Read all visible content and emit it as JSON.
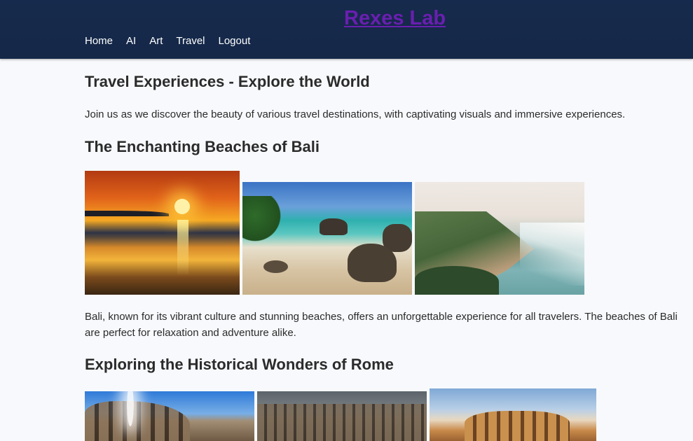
{
  "header": {
    "brand": "Rexes Lab",
    "nav": [
      "Home",
      "AI",
      "Art",
      "Travel",
      "Logout"
    ]
  },
  "main": {
    "title": "Travel Experiences - Explore the World",
    "intro": "Join us as we discover the beauty of various travel destinations, with captivating visuals and immersive experiences.",
    "sections": [
      {
        "heading": "The Enchanting Beaches of Bali",
        "description": "Bali, known for its vibrant culture and stunning beaches, offers an unforgettable experience for all travelers. The beaches of Bali are perfect for relaxation and adventure alike.",
        "photos": [
          "sunset-beach-photo",
          "rocky-cove-photo",
          "coastline-cliff-photo"
        ]
      },
      {
        "heading": "Exploring the Historical Wonders of Rome",
        "photos": [
          "colosseum-sunburst-photo",
          "colosseum-interior-photo",
          "colosseum-exterior-photo"
        ]
      }
    ]
  },
  "colors": {
    "header_bg": "#152848",
    "brand": "#6a1fb0",
    "nav_text": "#ffffff",
    "page_bg": "#f7f9fc",
    "text": "#2b2b2b"
  }
}
